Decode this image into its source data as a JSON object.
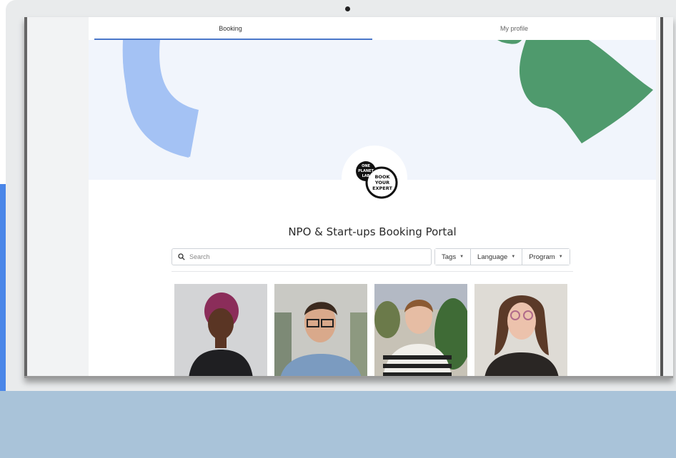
{
  "tabs": [
    {
      "label": "Booking",
      "active": true
    },
    {
      "label": "My profile",
      "active": false
    }
  ],
  "brand": {
    "line1": "ONE",
    "line2": "PLANET",
    "line3": "LAB",
    "book_line1": "BOOK",
    "book_line2": "YOUR",
    "book_line3": "EXPERT"
  },
  "portal_title": "NPO & Start-ups Booking Portal",
  "search": {
    "placeholder": "Search",
    "value": ""
  },
  "filters": [
    {
      "label": "Tags",
      "icon": "caret-down-icon"
    },
    {
      "label": "Language",
      "icon": "caret-down-icon"
    },
    {
      "label": "Program",
      "icon": "caret-down-icon"
    }
  ],
  "experts": [
    {
      "photo": "expert-photo-1"
    },
    {
      "photo": "expert-photo-2"
    },
    {
      "photo": "expert-photo-3"
    },
    {
      "photo": "expert-photo-4"
    }
  ],
  "colors": {
    "accent": "#4a77c9",
    "hero_bg": "#f1f5fc",
    "blue_shape": "#a4c2f4",
    "green_shape": "#4f9a6d",
    "backdrop_band": "#a9c3d9"
  }
}
